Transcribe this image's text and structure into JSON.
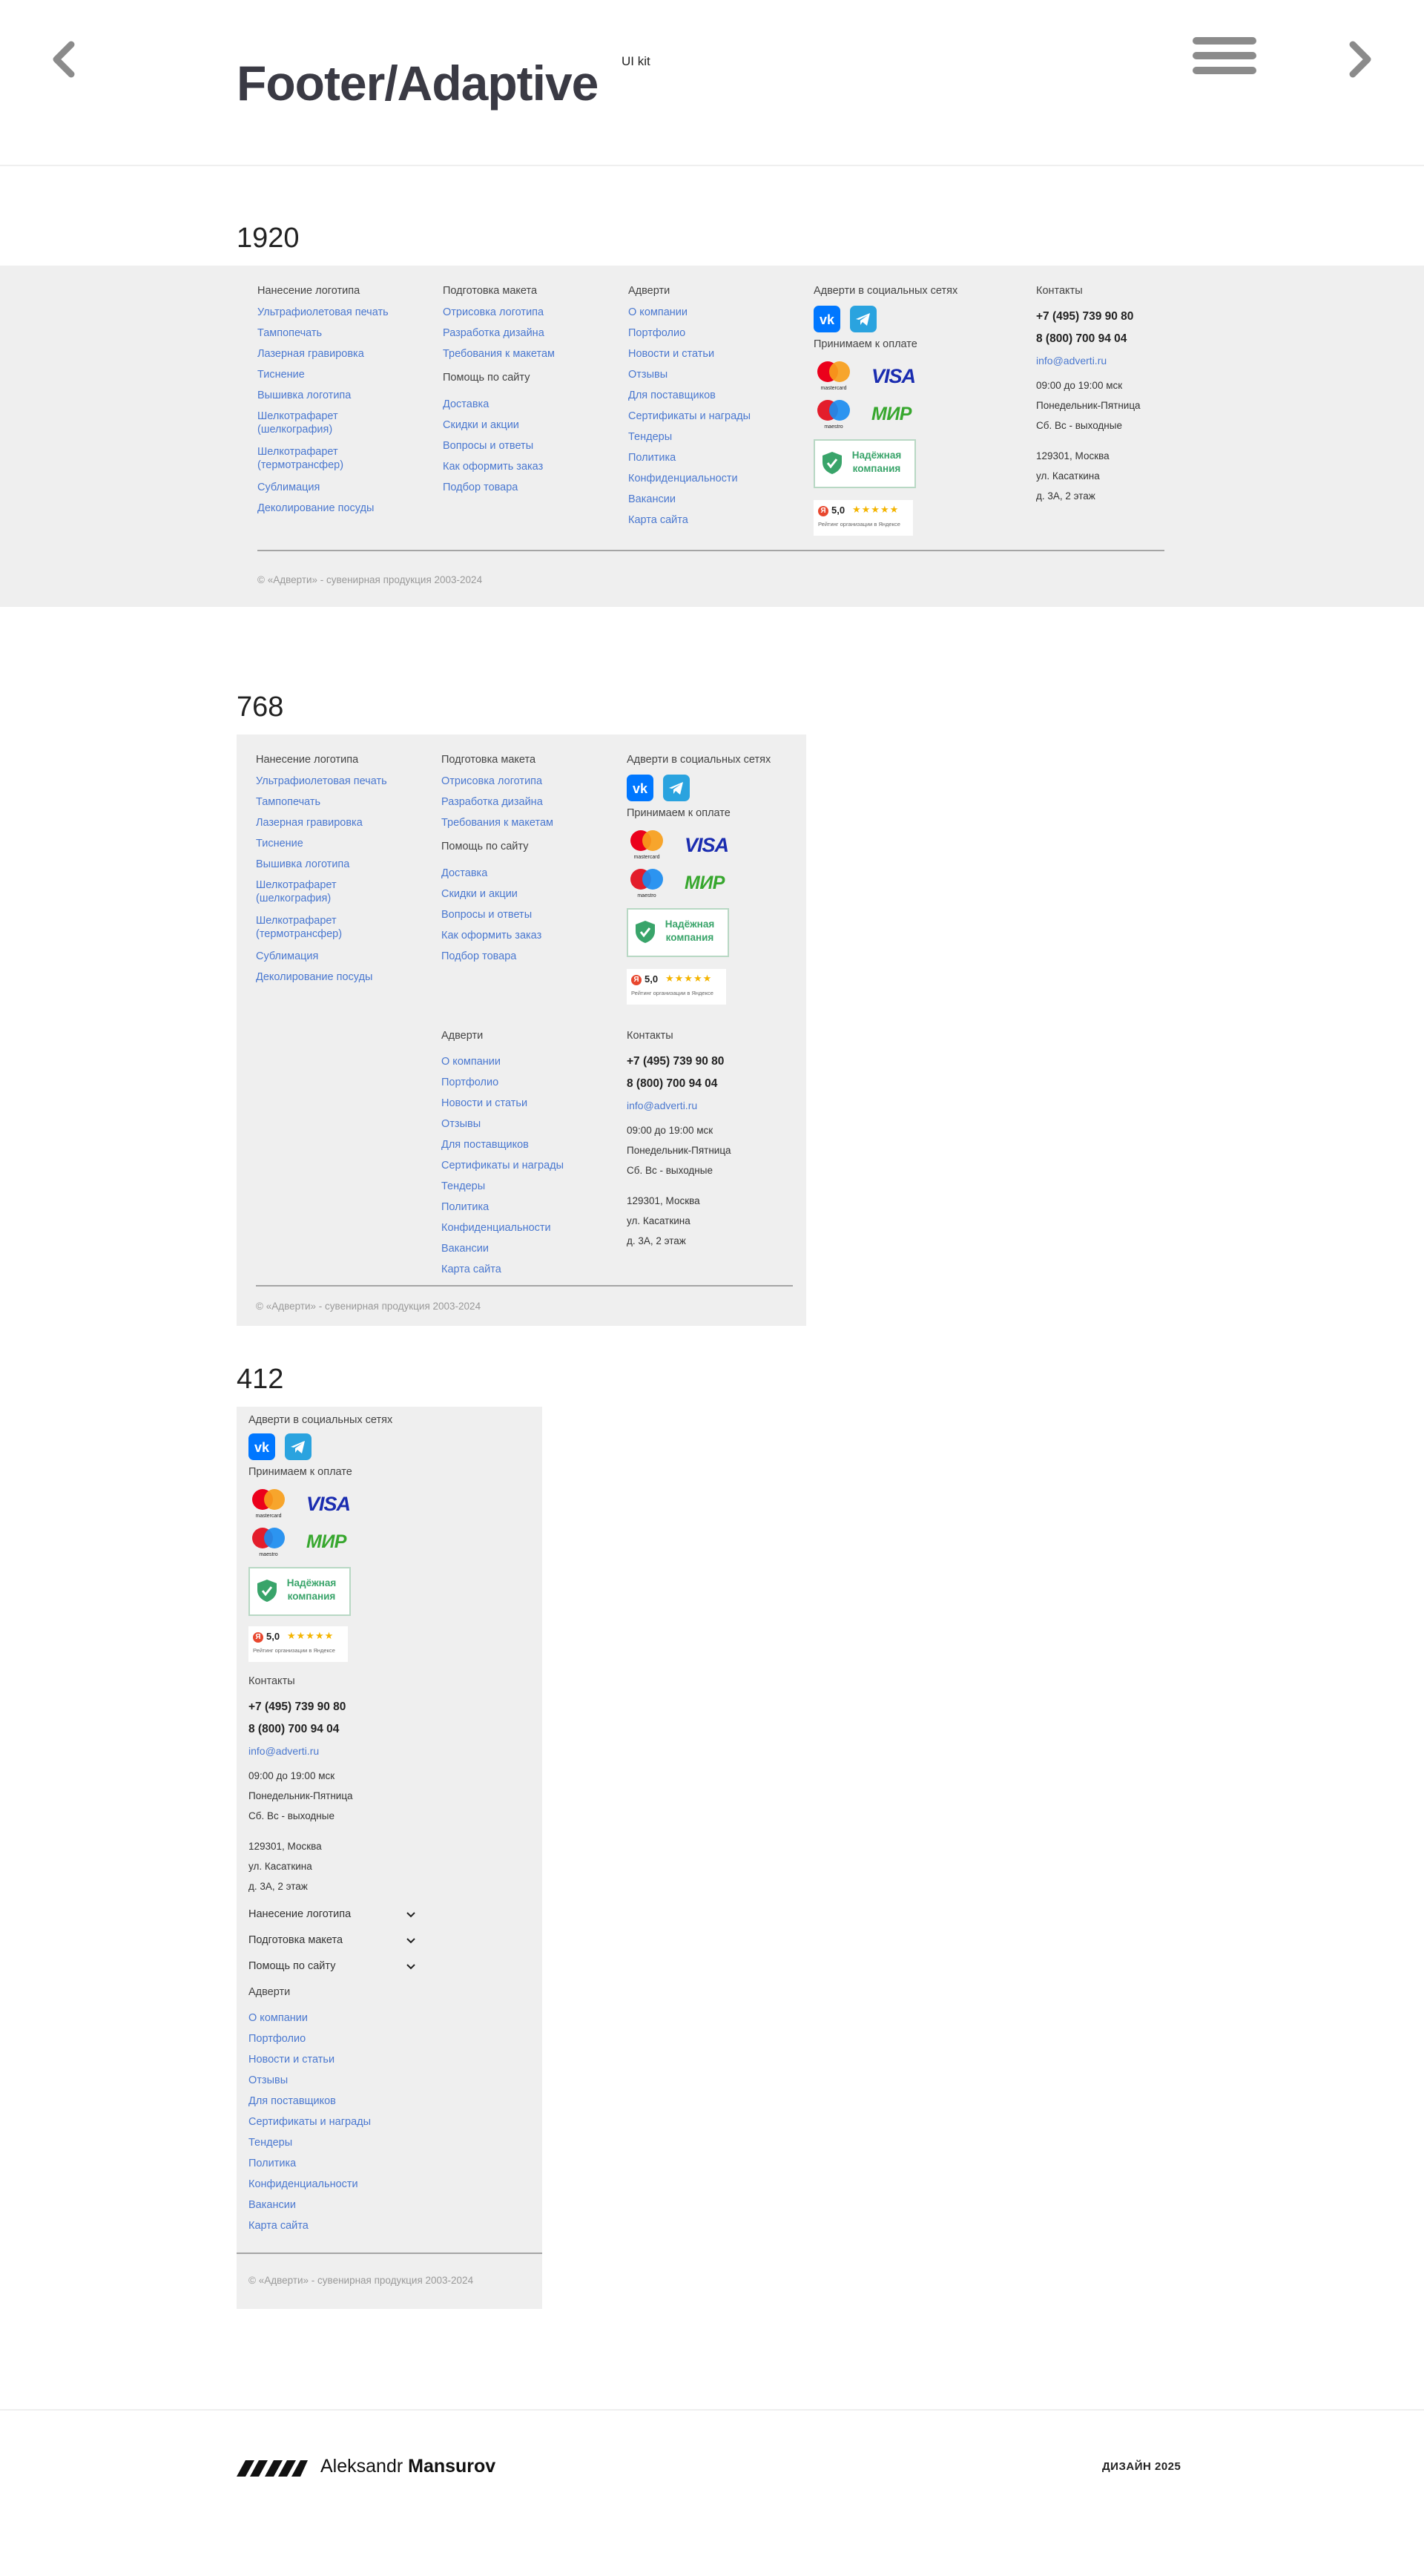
{
  "header": {
    "title": "Footer/Adaptive",
    "tag": "UI kit",
    "prev_icon": "chevron-left-icon",
    "next_icon": "chevron-right-icon",
    "menu_icon": "hamburger-menu-icon"
  },
  "breakpoints": [
    "1920",
    "768",
    "412"
  ],
  "footer": {
    "col_logo": {
      "title": "Нанесение логотипа",
      "items": [
        "Ультрафиолетовая печать",
        "Тампопечать",
        "Лазерная гравировка",
        "Тиснение",
        "Вышивка логотипа",
        "Шелкотрафарет (шелкография)",
        "Шелкотрафарет (термотрансфер)",
        "Сублимация",
        "Деколирование посуды"
      ]
    },
    "col_layout": {
      "title": "Подготовка макета",
      "items": [
        "Отрисовка логотипа",
        "Разработка дизайна",
        "Требования к макетам"
      ]
    },
    "col_help": {
      "title": "Помощь по сайту",
      "items": [
        "Доставка",
        "Скидки и акции",
        "Вопросы и ответы",
        "Как оформить заказ",
        "Подбор товара"
      ]
    },
    "col_company": {
      "title": "Адверти",
      "items": [
        "О компании",
        "Портфолио",
        "Новости и статьи",
        "Отзывы",
        "Для поставщиков",
        "Сертификаты и награды",
        "Тендеры",
        "Политика",
        "Конфиденциальности",
        "Вакансии",
        "Карта сайта"
      ]
    },
    "social": {
      "title": "Адверти в социальных сетях",
      "vk_icon": "vk-icon",
      "tg_icon": "telegram-icon"
    },
    "payment": {
      "title": "Принимаем к оплате",
      "mastercard": "mastercard",
      "visa": "VISA",
      "maestro": "maestro",
      "mir": "МИР"
    },
    "badge": {
      "line1": "Надёжная",
      "line2": "компания"
    },
    "rating": {
      "score": "5,0",
      "stars": "★★★★★",
      "caption": "Рейтинг организации в Яндексе",
      "letter": "Я"
    },
    "contacts": {
      "title": "Контакты",
      "phone1": "+7 (495) 739 90 80",
      "phone2": "8 (800) 700 94 04",
      "email": "info@adverti.ru",
      "hours1": "09:00 до 19:00 мск",
      "hours2": "Понедельник-Пятница",
      "hours3": "Сб. Вс - выходные",
      "addr1": "129301, Москва",
      "addr2": "ул. Касаткина",
      "addr3": "д. 3А, 2 этаж"
    },
    "copyright": "© «Адверти» - сувенирная продукция 2003-2024"
  },
  "bottom": {
    "logo_icon": "author-logo-icon",
    "first_name": "Aleksandr",
    "last_name": "Mansurov",
    "credit": "ДИЗАЙН 2025"
  },
  "colors": {
    "link": "#4a78d0",
    "footer_bg": "#efefef",
    "title": "#3a3a44",
    "badge_green": "#39a46a"
  }
}
